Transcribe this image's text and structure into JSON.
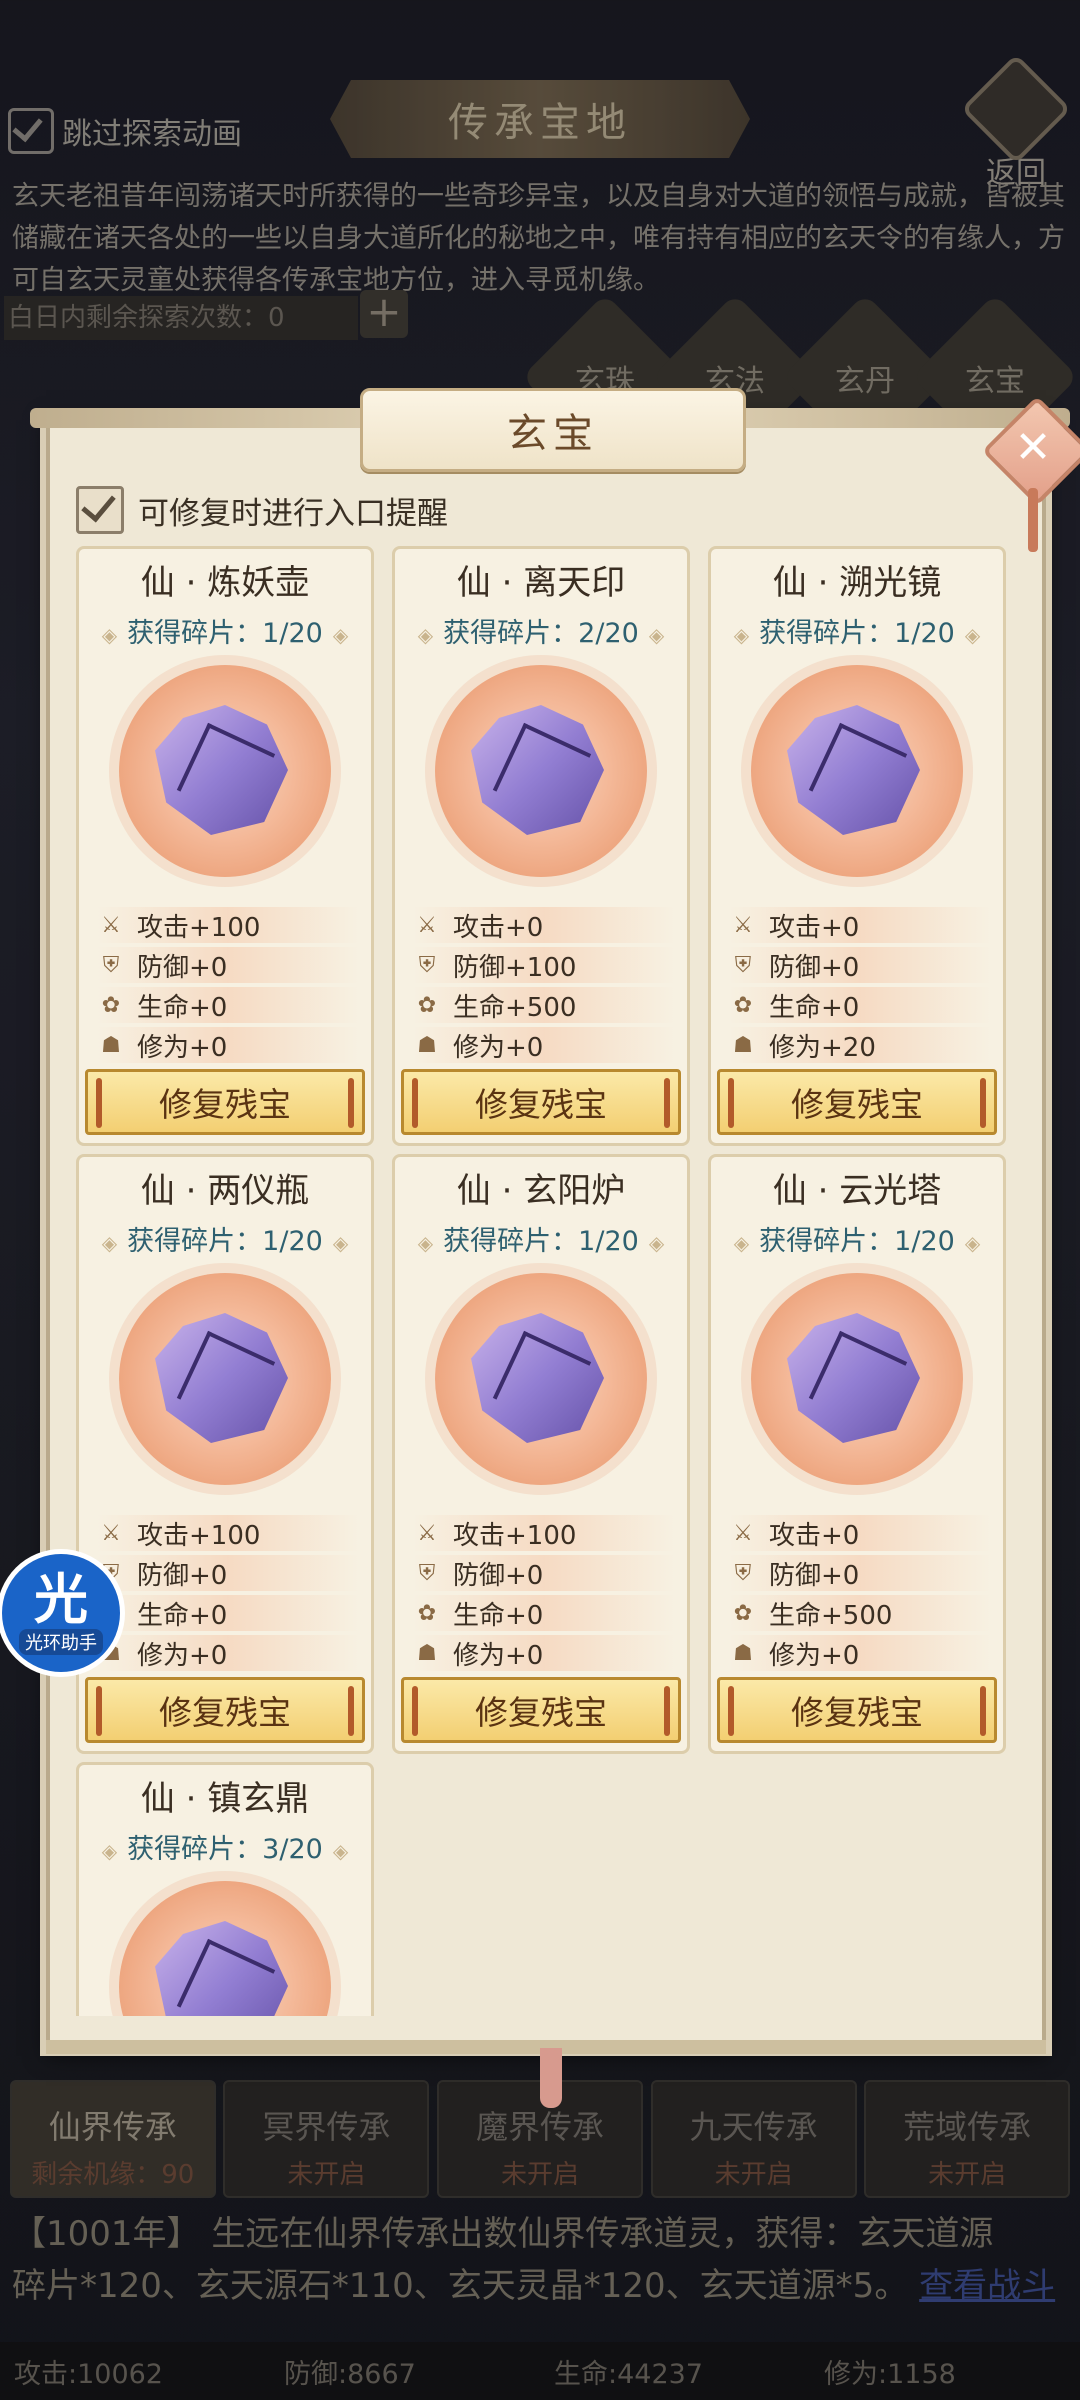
{
  "top": {
    "skip_label": "跳过探索动画",
    "title": "传承宝地",
    "back_label": "返回",
    "intro": "玄天老祖昔年闯荡诸天时所获得的一些奇珍异宝，以及自身对大道的领悟与成就，皆被其储藏在诸天各处的一些以自身大道所化的秘地之中，唯有持有相应的玄天令的有缘人，方可自玄天灵童处获得各传承宝地方位，进入寻觅机缘。",
    "explore_count": "白日内剩余探索次数：0",
    "plus": "+",
    "categories": [
      "玄珠",
      "玄法",
      "玄丹",
      "玄宝"
    ]
  },
  "modal": {
    "title": "玄宝",
    "close": "✕",
    "remind_label": "可修复时进行入口提醒",
    "cards": [
      {
        "name": "仙 · 炼妖壶",
        "frags": "获得碎片：1/20",
        "atk": "攻击+100",
        "def": "防御+0",
        "hp": "生命+0",
        "cult": "修为+0",
        "btn": "修复残宝"
      },
      {
        "name": "仙 · 离天印",
        "frags": "获得碎片：2/20",
        "atk": "攻击+0",
        "def": "防御+100",
        "hp": "生命+500",
        "cult": "修为+0",
        "btn": "修复残宝"
      },
      {
        "name": "仙 · 溯光镜",
        "frags": "获得碎片：1/20",
        "atk": "攻击+0",
        "def": "防御+0",
        "hp": "生命+0",
        "cult": "修为+20",
        "btn": "修复残宝"
      },
      {
        "name": "仙 · 两仪瓶",
        "frags": "获得碎片：1/20",
        "atk": "攻击+100",
        "def": "防御+0",
        "hp": "生命+0",
        "cult": "修为+0",
        "btn": "修复残宝"
      },
      {
        "name": "仙 · 玄阳炉",
        "frags": "获得碎片：1/20",
        "atk": "攻击+100",
        "def": "防御+0",
        "hp": "生命+0",
        "cult": "修为+0",
        "btn": "修复残宝"
      },
      {
        "name": "仙 · 云光塔",
        "frags": "获得碎片：1/20",
        "atk": "攻击+0",
        "def": "防御+0",
        "hp": "生命+500",
        "cult": "修为+0",
        "btn": "修复残宝"
      },
      {
        "name": "仙 · 镇玄鼎",
        "frags": "获得碎片：3/20",
        "atk": "",
        "def": "",
        "hp": "",
        "cult": "",
        "btn": ""
      }
    ]
  },
  "helper": {
    "big": "光",
    "small": "光环助手"
  },
  "bottom": {
    "tabs": [
      {
        "label": "仙界传承",
        "sub": "剩余机缘：90"
      },
      {
        "label": "冥界传承",
        "sub": "未开启"
      },
      {
        "label": "魔界传承",
        "sub": "未开启"
      },
      {
        "label": "九天传承",
        "sub": "未开启"
      },
      {
        "label": "荒域传承",
        "sub": "未开启"
      }
    ],
    "log_line1": "【1001年】 生远在仙界传承出数仙界传承道灵，获得：玄天道源",
    "log_line2": "碎片*120、玄天源石*110、玄天灵晶*120、玄天道源*5。",
    "log_link": "查看战斗",
    "stats": [
      "攻击:10062",
      "防御:8667",
      "生命:44237",
      "修为:1158"
    ]
  }
}
